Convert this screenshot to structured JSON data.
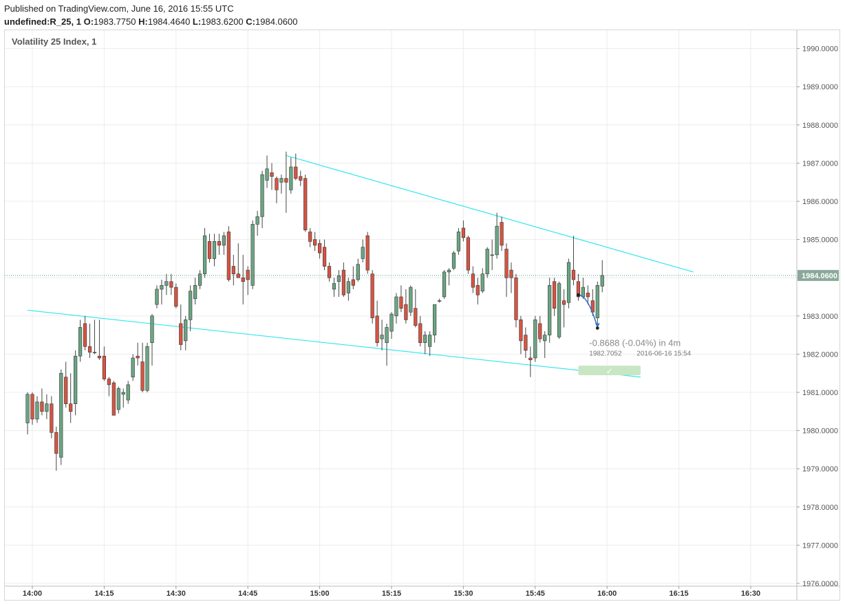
{
  "header": {
    "published": "Published on TradingView.com, June 16, 2016 15:55 UTC",
    "symbol_interval": "undefined:R_25, 1",
    "o_label": "O:",
    "o_value": "1983.7750",
    "h_label": "H:",
    "h_value": "1984.4640",
    "l_label": "L:",
    "l_value": "1983.6200",
    "c_label": "C:",
    "c_value": "1984.0600"
  },
  "chart_data": {
    "type": "candlestick",
    "title": "Volatility 25 Index, 1",
    "last_price": 1984.06,
    "last_price_label": "1984.0600",
    "y_ticks": [
      "1990.0000",
      "1989.0000",
      "1988.0000",
      "1987.0000",
      "1986.0000",
      "1985.0000",
      "1984.0000",
      "1983.0000",
      "1982.0000",
      "1981.0000",
      "1980.0000",
      "1979.0000",
      "1978.0000",
      "1977.0000",
      "1976.0000"
    ],
    "x_ticks": [
      "14:00",
      "14:15",
      "14:30",
      "14:45",
      "15:00",
      "15:15",
      "15:30",
      "15:45",
      "16:00",
      "16:15",
      "16:30"
    ],
    "ylim": [
      1975.9,
      1990.5
    ],
    "xlim": [
      "13:59",
      "16:39"
    ],
    "grid": true,
    "colors": {
      "up": "#6ba583",
      "down": "#d75442",
      "wick": "#444444",
      "trendline": "#2ee6ee",
      "price_line": "#4a9a8a",
      "label_bg": "#8aa99a",
      "projection_box": "#c8e6c4"
    },
    "candles": [
      {
        "t": "13:59",
        "o": 1980.2,
        "h": 1981.0,
        "l": 1979.9,
        "c": 1980.95
      },
      {
        "t": "14:00",
        "o": 1980.95,
        "h": 1981.0,
        "l": 1980.15,
        "c": 1980.3
      },
      {
        "t": "14:01",
        "o": 1980.3,
        "h": 1980.9,
        "l": 1980.2,
        "c": 1980.75
      },
      {
        "t": "14:02",
        "o": 1980.75,
        "h": 1981.1,
        "l": 1980.4,
        "c": 1980.5
      },
      {
        "t": "14:03",
        "o": 1980.5,
        "h": 1980.95,
        "l": 1980.3,
        "c": 1980.7
      },
      {
        "t": "14:04",
        "o": 1980.7,
        "h": 1980.9,
        "l": 1979.8,
        "c": 1979.95
      },
      {
        "t": "14:05",
        "o": 1979.95,
        "h": 1980.1,
        "l": 1978.95,
        "c": 1979.4
      },
      {
        "t": "14:06",
        "o": 1979.3,
        "h": 1981.6,
        "l": 1979.1,
        "c": 1981.5
      },
      {
        "t": "14:07",
        "o": 1981.4,
        "h": 1981.8,
        "l": 1980.6,
        "c": 1980.7
      },
      {
        "t": "14:08",
        "o": 1980.7,
        "h": 1981.5,
        "l": 1980.2,
        "c": 1980.5
      },
      {
        "t": "14:09",
        "o": 1980.7,
        "h": 1982.1,
        "l": 1980.4,
        "c": 1981.95
      },
      {
        "t": "14:10",
        "o": 1981.95,
        "h": 1982.9,
        "l": 1981.8,
        "c": 1982.7
      },
      {
        "t": "14:11",
        "o": 1982.8,
        "h": 1983.0,
        "l": 1982.1,
        "c": 1982.2
      },
      {
        "t": "14:12",
        "o": 1982.2,
        "h": 1982.8,
        "l": 1981.9,
        "c": 1982.05
      },
      {
        "t": "14:13",
        "o": 1982.05,
        "h": 1982.9,
        "l": 1982.0,
        "c": 1982.05
      },
      {
        "t": "14:14",
        "o": 1981.95,
        "h": 1982.9,
        "l": 1981.85,
        "c": 1981.9
      },
      {
        "t": "14:15",
        "o": 1981.95,
        "h": 1982.2,
        "l": 1981.3,
        "c": 1981.35
      },
      {
        "t": "14:16",
        "o": 1981.35,
        "h": 1981.4,
        "l": 1980.9,
        "c": 1981.2
      },
      {
        "t": "14:17",
        "o": 1981.25,
        "h": 1981.3,
        "l": 1980.4,
        "c": 1980.4
      },
      {
        "t": "14:18",
        "o": 1980.55,
        "h": 1981.15,
        "l": 1980.45,
        "c": 1981.1
      },
      {
        "t": "14:19",
        "o": 1980.95,
        "h": 1981.1,
        "l": 1980.6,
        "c": 1981.0
      },
      {
        "t": "14:20",
        "o": 1980.8,
        "h": 1981.3,
        "l": 1980.7,
        "c": 1981.2
      },
      {
        "t": "14:21",
        "o": 1981.4,
        "h": 1982.0,
        "l": 1981.3,
        "c": 1981.9
      },
      {
        "t": "14:22",
        "o": 1981.95,
        "h": 1982.3,
        "l": 1981.7,
        "c": 1981.9
      },
      {
        "t": "14:23",
        "o": 1981.8,
        "h": 1982.3,
        "l": 1981.0,
        "c": 1981.05
      },
      {
        "t": "14:24",
        "o": 1981.05,
        "h": 1982.3,
        "l": 1981.0,
        "c": 1982.2
      },
      {
        "t": "14:25",
        "o": 1982.3,
        "h": 1983.05,
        "l": 1981.7,
        "c": 1983.0
      },
      {
        "t": "14:26",
        "o": 1983.3,
        "h": 1983.8,
        "l": 1983.2,
        "c": 1983.7
      },
      {
        "t": "14:27",
        "o": 1983.7,
        "h": 1983.95,
        "l": 1983.3,
        "c": 1983.8
      },
      {
        "t": "14:28",
        "o": 1983.8,
        "h": 1984.1,
        "l": 1983.55,
        "c": 1983.9
      },
      {
        "t": "14:29",
        "o": 1983.9,
        "h": 1984.1,
        "l": 1983.55,
        "c": 1983.75
      },
      {
        "t": "14:30",
        "o": 1983.75,
        "h": 1983.85,
        "l": 1983.2,
        "c": 1983.25
      },
      {
        "t": "14:31",
        "o": 1982.8,
        "h": 1983.3,
        "l": 1982.1,
        "c": 1982.25
      },
      {
        "t": "14:32",
        "o": 1982.35,
        "h": 1983.0,
        "l": 1982.1,
        "c": 1982.9
      },
      {
        "t": "14:33",
        "o": 1982.9,
        "h": 1983.8,
        "l": 1982.6,
        "c": 1983.65
      },
      {
        "t": "14:34",
        "o": 1983.45,
        "h": 1984.0,
        "l": 1983.3,
        "c": 1983.8
      },
      {
        "t": "14:35",
        "o": 1983.8,
        "h": 1984.2,
        "l": 1983.7,
        "c": 1984.1
      },
      {
        "t": "14:36",
        "o": 1984.1,
        "h": 1985.3,
        "l": 1984.0,
        "c": 1985.1
      },
      {
        "t": "14:37",
        "o": 1984.95,
        "h": 1985.15,
        "l": 1984.4,
        "c": 1984.5
      },
      {
        "t": "14:38",
        "o": 1984.5,
        "h": 1985.15,
        "l": 1984.3,
        "c": 1984.95
      },
      {
        "t": "14:39",
        "o": 1984.95,
        "h": 1985.15,
        "l": 1984.6,
        "c": 1984.85
      },
      {
        "t": "14:40",
        "o": 1984.85,
        "h": 1985.2,
        "l": 1984.6,
        "c": 1985.1
      },
      {
        "t": "14:41",
        "o": 1985.2,
        "h": 1985.35,
        "l": 1983.9,
        "c": 1983.95
      },
      {
        "t": "14:42",
        "o": 1984.3,
        "h": 1984.6,
        "l": 1983.8,
        "c": 1984.1
      },
      {
        "t": "14:43",
        "o": 1984.1,
        "h": 1984.9,
        "l": 1984.0,
        "c": 1984.0
      },
      {
        "t": "14:44",
        "o": 1984.0,
        "h": 1984.6,
        "l": 1983.3,
        "c": 1983.9
      },
      {
        "t": "14:45",
        "o": 1984.2,
        "h": 1984.3,
        "l": 1983.55,
        "c": 1983.95
      },
      {
        "t": "14:46",
        "o": 1983.8,
        "h": 1985.5,
        "l": 1983.7,
        "c": 1985.4
      },
      {
        "t": "14:47",
        "o": 1985.4,
        "h": 1985.75,
        "l": 1985.1,
        "c": 1985.6
      },
      {
        "t": "14:48",
        "o": 1985.6,
        "h": 1986.8,
        "l": 1985.3,
        "c": 1986.7
      },
      {
        "t": "14:49",
        "o": 1986.55,
        "h": 1987.2,
        "l": 1986.35,
        "c": 1986.85
      },
      {
        "t": "14:50",
        "o": 1986.75,
        "h": 1987.0,
        "l": 1986.3,
        "c": 1986.65
      },
      {
        "t": "14:51",
        "o": 1986.6,
        "h": 1986.65,
        "l": 1985.95,
        "c": 1986.3
      },
      {
        "t": "14:52",
        "o": 1986.5,
        "h": 1986.7,
        "l": 1986.2,
        "c": 1986.6
      },
      {
        "t": "14:53",
        "o": 1986.6,
        "h": 1987.3,
        "l": 1985.7,
        "c": 1986.5
      },
      {
        "t": "14:54",
        "o": 1986.3,
        "h": 1987.15,
        "l": 1986.2,
        "c": 1986.9
      },
      {
        "t": "14:55",
        "o": 1986.9,
        "h": 1987.25,
        "l": 1986.55,
        "c": 1986.6
      },
      {
        "t": "14:56",
        "o": 1986.65,
        "h": 1986.8,
        "l": 1986.4,
        "c": 1986.55
      },
      {
        "t": "14:57",
        "o": 1986.6,
        "h": 1986.7,
        "l": 1985.2,
        "c": 1985.25
      },
      {
        "t": "14:58",
        "o": 1985.2,
        "h": 1985.3,
        "l": 1984.8,
        "c": 1984.95
      },
      {
        "t": "14:59",
        "o": 1985.0,
        "h": 1985.2,
        "l": 1984.7,
        "c": 1984.85
      },
      {
        "t": "15:00",
        "o": 1984.9,
        "h": 1985.0,
        "l": 1984.5,
        "c": 1984.65
      },
      {
        "t": "15:01",
        "o": 1984.8,
        "h": 1985.0,
        "l": 1984.2,
        "c": 1984.3
      },
      {
        "t": "15:02",
        "o": 1984.3,
        "h": 1984.4,
        "l": 1983.9,
        "c": 1984.0
      },
      {
        "t": "15:03",
        "o": 1983.7,
        "h": 1984.0,
        "l": 1983.5,
        "c": 1983.85
      },
      {
        "t": "15:04",
        "o": 1983.9,
        "h": 1984.2,
        "l": 1983.5,
        "c": 1984.05
      },
      {
        "t": "15:05",
        "o": 1984.2,
        "h": 1984.4,
        "l": 1983.5,
        "c": 1983.55
      },
      {
        "t": "15:06",
        "o": 1983.6,
        "h": 1984.0,
        "l": 1983.4,
        "c": 1983.9
      },
      {
        "t": "15:07",
        "o": 1983.95,
        "h": 1984.3,
        "l": 1983.7,
        "c": 1983.8
      },
      {
        "t": "15:08",
        "o": 1983.95,
        "h": 1984.5,
        "l": 1983.9,
        "c": 1984.35
      },
      {
        "t": "15:09",
        "o": 1984.5,
        "h": 1985.0,
        "l": 1984.4,
        "c": 1984.8
      },
      {
        "t": "15:10",
        "o": 1985.1,
        "h": 1985.2,
        "l": 1984.1,
        "c": 1984.2
      },
      {
        "t": "15:11",
        "o": 1984.1,
        "h": 1984.2,
        "l": 1982.8,
        "c": 1982.95
      },
      {
        "t": "15:12",
        "o": 1983.0,
        "h": 1983.4,
        "l": 1982.2,
        "c": 1982.3
      },
      {
        "t": "15:13",
        "o": 1982.4,
        "h": 1982.9,
        "l": 1982.1,
        "c": 1982.5
      },
      {
        "t": "15:14",
        "o": 1982.3,
        "h": 1982.8,
        "l": 1981.7,
        "c": 1982.7
      },
      {
        "t": "15:15",
        "o": 1982.6,
        "h": 1983.1,
        "l": 1982.4,
        "c": 1983.05
      },
      {
        "t": "15:16",
        "o": 1983.0,
        "h": 1983.6,
        "l": 1982.8,
        "c": 1983.5
      },
      {
        "t": "15:17",
        "o": 1983.5,
        "h": 1983.8,
        "l": 1983.1,
        "c": 1983.2
      },
      {
        "t": "15:18",
        "o": 1983.3,
        "h": 1983.7,
        "l": 1982.8,
        "c": 1982.9
      },
      {
        "t": "15:19",
        "o": 1983.1,
        "h": 1983.8,
        "l": 1983.0,
        "c": 1983.75
      },
      {
        "t": "15:20",
        "o": 1983.2,
        "h": 1983.7,
        "l": 1982.7,
        "c": 1982.75
      },
      {
        "t": "15:21",
        "o": 1982.8,
        "h": 1983.0,
        "l": 1982.2,
        "c": 1982.3
      },
      {
        "t": "15:22",
        "o": 1982.3,
        "h": 1982.6,
        "l": 1982.0,
        "c": 1982.5
      },
      {
        "t": "15:23",
        "o": 1982.2,
        "h": 1982.6,
        "l": 1981.95,
        "c": 1982.5
      },
      {
        "t": "15:24",
        "o": 1982.5,
        "h": 1983.3,
        "l": 1982.3,
        "c": 1983.3
      },
      {
        "t": "15:25",
        "o": 1983.4,
        "h": 1983.45,
        "l": 1983.35,
        "c": 1983.4
      },
      {
        "t": "15:26",
        "o": 1983.5,
        "h": 1984.2,
        "l": 1983.45,
        "c": 1984.15
      },
      {
        "t": "15:27",
        "o": 1984.15,
        "h": 1984.25,
        "l": 1983.8,
        "c": 1984.2
      },
      {
        "t": "15:28",
        "o": 1984.25,
        "h": 1984.7,
        "l": 1984.2,
        "c": 1984.65
      },
      {
        "t": "15:29",
        "o": 1984.7,
        "h": 1985.3,
        "l": 1984.6,
        "c": 1985.2
      },
      {
        "t": "15:30",
        "o": 1985.3,
        "h": 1985.5,
        "l": 1984.95,
        "c": 1985.05
      },
      {
        "t": "15:31",
        "o": 1985.05,
        "h": 1985.1,
        "l": 1984.1,
        "c": 1984.2
      },
      {
        "t": "15:32",
        "o": 1984.1,
        "h": 1984.3,
        "l": 1983.6,
        "c": 1983.75
      },
      {
        "t": "15:33",
        "o": 1983.8,
        "h": 1984.0,
        "l": 1983.3,
        "c": 1983.55
      },
      {
        "t": "15:34",
        "o": 1983.65,
        "h": 1984.25,
        "l": 1983.6,
        "c": 1984.1
      },
      {
        "t": "15:35",
        "o": 1984.1,
        "h": 1984.8,
        "l": 1984.0,
        "c": 1984.75
      },
      {
        "t": "15:36",
        "o": 1984.6,
        "h": 1985.0,
        "l": 1984.2,
        "c": 1984.6
      },
      {
        "t": "15:37",
        "o": 1984.6,
        "h": 1985.7,
        "l": 1984.5,
        "c": 1985.35
      },
      {
        "t": "15:38",
        "o": 1985.45,
        "h": 1985.6,
        "l": 1984.7,
        "c": 1984.85
      },
      {
        "t": "15:39",
        "o": 1984.75,
        "h": 1984.9,
        "l": 1983.5,
        "c": 1984.0
      },
      {
        "t": "15:40",
        "o": 1984.2,
        "h": 1984.4,
        "l": 1983.6,
        "c": 1984.0
      },
      {
        "t": "15:41",
        "o": 1984.0,
        "h": 1984.1,
        "l": 1982.7,
        "c": 1982.9
      },
      {
        "t": "15:42",
        "o": 1982.9,
        "h": 1983.0,
        "l": 1982.0,
        "c": 1982.35
      },
      {
        "t": "15:43",
        "o": 1982.5,
        "h": 1982.7,
        "l": 1981.9,
        "c": 1982.1
      },
      {
        "t": "15:44",
        "o": 1981.9,
        "h": 1982.2,
        "l": 1981.4,
        "c": 1981.85
      },
      {
        "t": "15:45",
        "o": 1981.9,
        "h": 1983.0,
        "l": 1981.8,
        "c": 1982.9
      },
      {
        "t": "15:46",
        "o": 1982.8,
        "h": 1983.0,
        "l": 1982.3,
        "c": 1982.4
      },
      {
        "t": "15:47",
        "o": 1982.35,
        "h": 1982.6,
        "l": 1981.9,
        "c": 1982.5
      },
      {
        "t": "15:48",
        "o": 1982.5,
        "h": 1984.0,
        "l": 1982.3,
        "c": 1983.8
      },
      {
        "t": "15:49",
        "o": 1983.9,
        "h": 1984.0,
        "l": 1983.0,
        "c": 1983.2
      },
      {
        "t": "15:50",
        "o": 1982.45,
        "h": 1983.9,
        "l": 1982.4,
        "c": 1983.85
      },
      {
        "t": "15:51",
        "o": 1983.4,
        "h": 1983.7,
        "l": 1982.7,
        "c": 1983.3
      },
      {
        "t": "15:52",
        "o": 1983.35,
        "h": 1984.5,
        "l": 1983.2,
        "c": 1984.4
      },
      {
        "t": "15:53",
        "o": 1984.2,
        "h": 1985.1,
        "l": 1983.8,
        "c": 1983.95
      },
      {
        "t": "15:54",
        "o": 1983.9,
        "h": 1984.1,
        "l": 1983.4,
        "c": 1983.5
      },
      {
        "t": "15:55",
        "o": 1983.5,
        "h": 1984.0,
        "l": 1983.45,
        "c": 1983.75
      },
      {
        "t": "15:56",
        "o": 1983.6,
        "h": 1983.8,
        "l": 1983.3,
        "c": 1983.5
      },
      {
        "t": "15:57",
        "o": 1983.4,
        "h": 1983.7,
        "l": 1983.0,
        "c": 1983.1
      },
      {
        "t": "15:58",
        "o": 1982.95,
        "h": 1983.9,
        "l": 1982.8,
        "c": 1983.8
      },
      {
        "t": "15:59",
        "o": 1983.78,
        "h": 1984.46,
        "l": 1983.62,
        "c": 1984.06
      }
    ],
    "trendlines": [
      {
        "name": "upper",
        "x1": "14:53",
        "y1": 1987.2,
        "x2": "16:18",
        "y2": 1984.15
      },
      {
        "name": "lower",
        "x1": "13:59",
        "y1": 1983.15,
        "x2": "16:07",
        "y2": 1981.4
      }
    ],
    "projection": {
      "start": {
        "t": "15:54",
        "p": 1983.55
      },
      "end": {
        "t": "15:58",
        "p": 1982.7
      },
      "box": {
        "t1": "15:54",
        "t2": "16:07",
        "p1": 1981.7,
        "p2": 1981.45
      },
      "change_text": "-0.8688 (-0.04%) in 4m",
      "price_text": "1982.7052",
      "time_text": "2016-06-16  15:54"
    }
  }
}
